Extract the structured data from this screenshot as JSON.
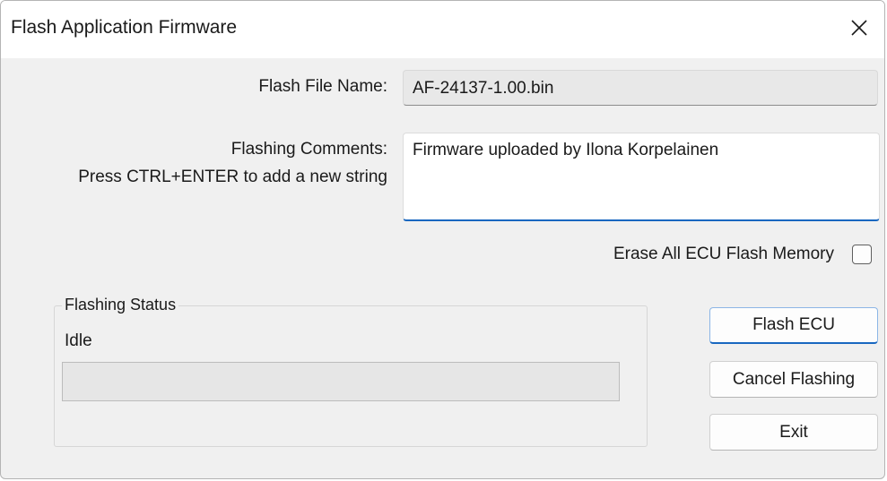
{
  "window": {
    "title": "Flash Application Firmware"
  },
  "icons": {
    "close": "close-icon"
  },
  "file": {
    "label": "Flash File Name:",
    "value": "AF-24137-1.00.bin"
  },
  "comments": {
    "label": "Flashing Comments:",
    "hint": "Press CTRL+ENTER to add a new string",
    "value": "Firmware uploaded by Ilona Korpelainen"
  },
  "erase": {
    "label": "Erase All ECU Flash Memory",
    "checked": false
  },
  "status": {
    "group_title": "Flashing Status",
    "text": "Idle",
    "progress_percent": 0
  },
  "buttons": {
    "flash": "Flash ECU",
    "cancel": "Cancel Flashing",
    "exit": "Exit"
  },
  "colors": {
    "accent": "#1867c0",
    "window_bg": "#f0f0f0"
  }
}
